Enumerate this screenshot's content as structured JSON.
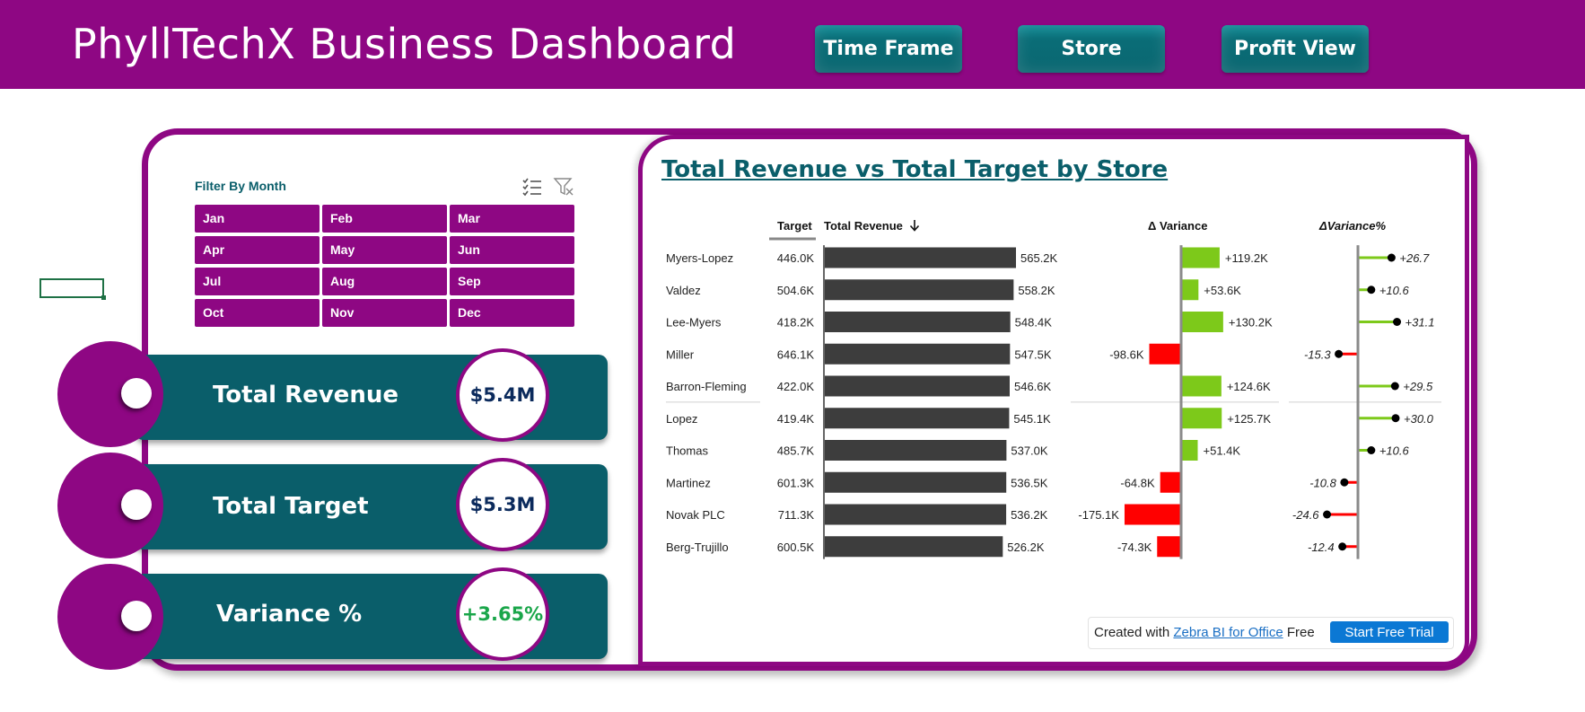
{
  "header": {
    "title": "PhyllTechX Business Dashboard",
    "buttons": [
      "Time Frame",
      "Store",
      "Profit View"
    ]
  },
  "filter": {
    "title": "Filter By Month",
    "months": [
      "Jan",
      "Feb",
      "Mar",
      "Apr",
      "May",
      "Jun",
      "Jul",
      "Aug",
      "Sep",
      "Oct",
      "Nov",
      "Dec"
    ],
    "icons": [
      "multi-select-icon",
      "clear-filter-icon"
    ]
  },
  "kpis": [
    {
      "label": "Total Revenue",
      "value": "$5.4M"
    },
    {
      "label": "Total Target",
      "value": "$5.3M"
    },
    {
      "label": "Variance %",
      "value": "+3.65%"
    }
  ],
  "colors": {
    "brand_purple": "#8e0783",
    "kpi_teal": "#0a5e6a",
    "revenue_bar": "#3d3d3d",
    "positive": "#7dc91a",
    "negative": "#ff0000",
    "kpi_positive_text": "#1aa64a",
    "badge_text": "#0b2a5c"
  },
  "chart_data": {
    "type": "bar",
    "title": "Total Revenue vs Total Target by Store",
    "columns": {
      "target": "Target",
      "revenue": "Total Revenue",
      "revenue_sort_icon": "arrow-down-icon",
      "variance": "Δ Variance",
      "variance_pct": "ΔVariance%"
    },
    "categories": [
      "Myers-Lopez",
      "Valdez",
      "Lee-Myers",
      "Miller",
      "Barron-Fleming",
      "Lopez",
      "Thomas",
      "Martinez",
      "Novak PLC",
      "Berg-Trujillo"
    ],
    "series": [
      {
        "name": "Target",
        "labels": [
          "446.0K",
          "504.6K",
          "418.2K",
          "646.1K",
          "422.0K",
          "419.4K",
          "485.7K",
          "601.3K",
          "711.3K",
          "600.5K"
        ],
        "values": [
          446.0,
          504.6,
          418.2,
          646.1,
          422.0,
          419.4,
          485.7,
          601.3,
          711.3,
          600.5
        ]
      },
      {
        "name": "Total Revenue",
        "labels": [
          "565.2K",
          "558.2K",
          "548.4K",
          "547.5K",
          "546.6K",
          "545.1K",
          "537.0K",
          "536.5K",
          "536.2K",
          "526.2K"
        ],
        "values": [
          565.2,
          558.2,
          548.4,
          547.5,
          546.6,
          545.1,
          537.0,
          536.5,
          536.2,
          526.2
        ]
      },
      {
        "name": "Δ Variance",
        "labels": [
          "+119.2K",
          "+53.6K",
          "+130.2K",
          "-98.6K",
          "+124.6K",
          "+125.7K",
          "+51.4K",
          "-64.8K",
          "-175.1K",
          "-74.3K"
        ],
        "values": [
          119.2,
          53.6,
          130.2,
          -98.6,
          124.6,
          125.7,
          51.4,
          -64.8,
          -175.1,
          -74.3
        ]
      },
      {
        "name": "ΔVariance%",
        "labels": [
          "+26.7",
          "+10.6",
          "+31.1",
          "-15.3",
          "+29.5",
          "+30.0",
          "+10.6",
          "-10.8",
          "-24.6",
          "-12.4"
        ],
        "values": [
          26.7,
          10.6,
          31.1,
          -15.3,
          29.5,
          30.0,
          10.6,
          -10.8,
          -24.6,
          -12.4
        ]
      }
    ]
  },
  "footer": {
    "prefix": "Created with",
    "link": "Zebra BI for Office",
    "suffix": "Free",
    "button": "Start Free Trial"
  }
}
